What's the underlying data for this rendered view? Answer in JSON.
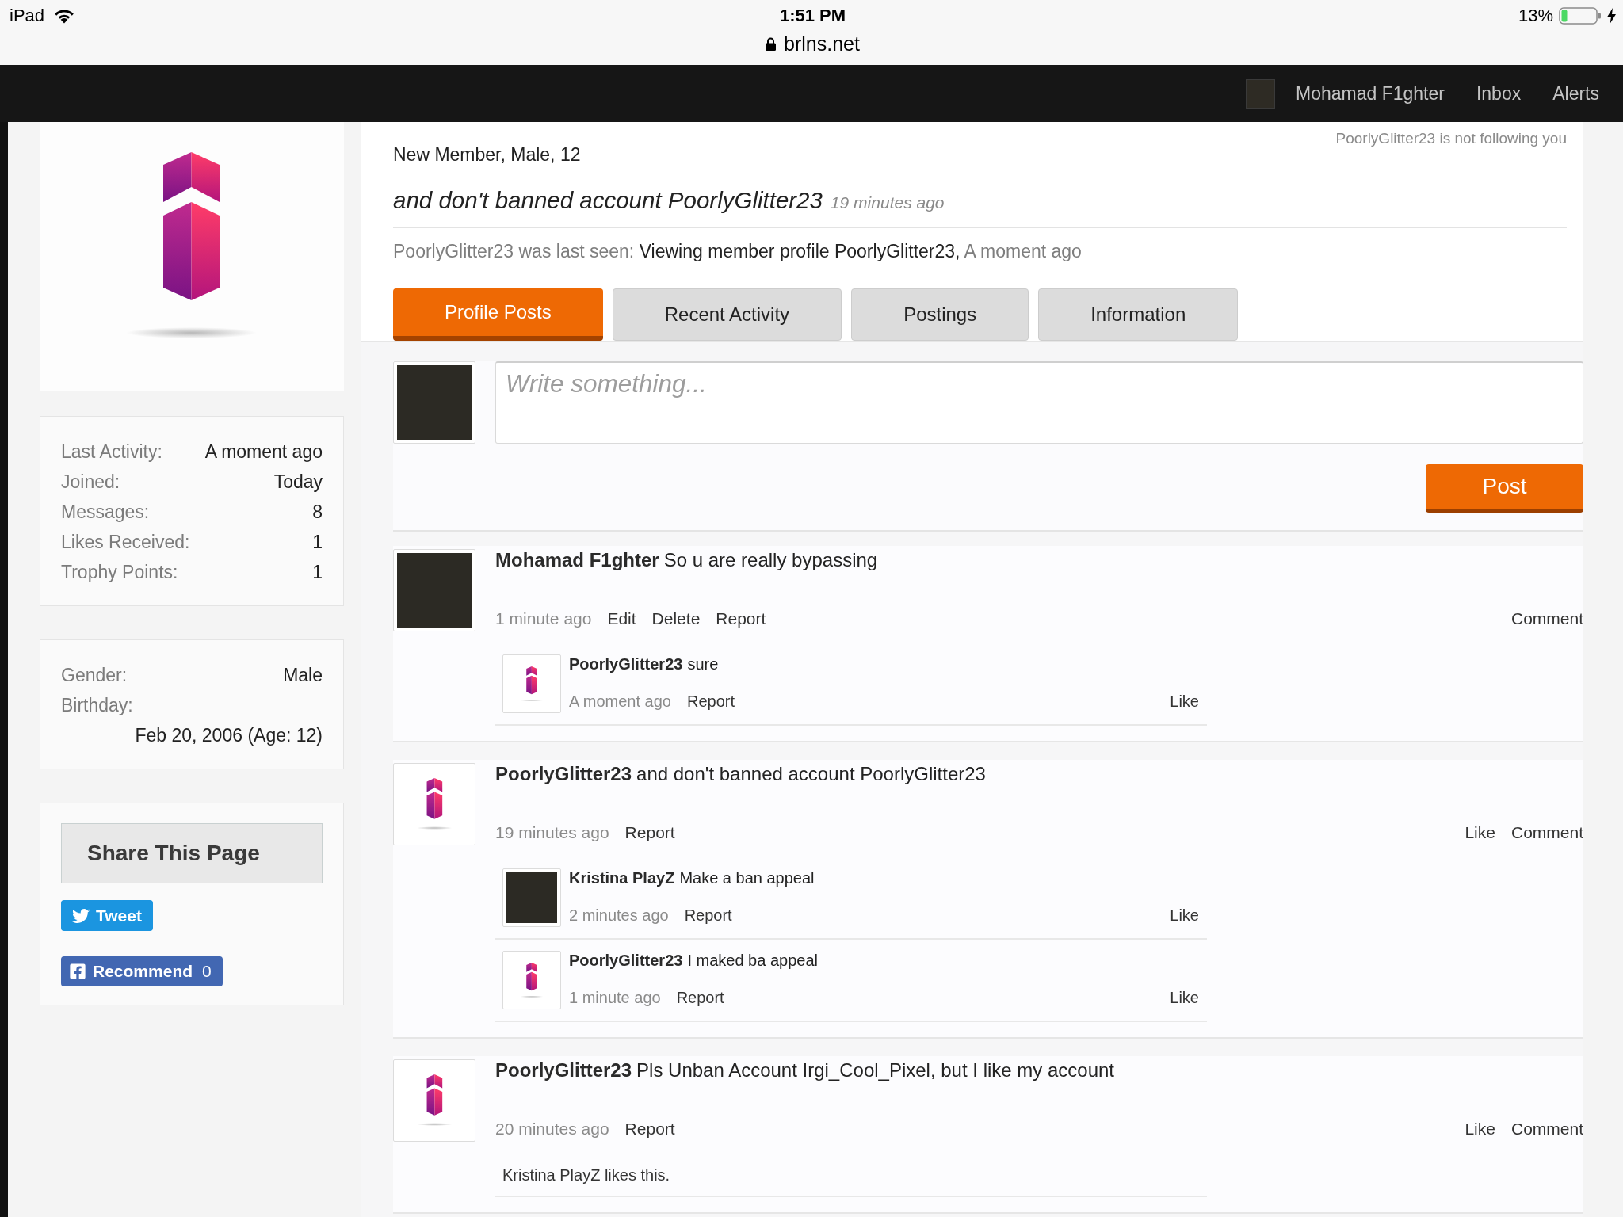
{
  "status_bar": {
    "device": "iPad",
    "time": "1:51 PM",
    "url": "brlns.net",
    "battery": "13%"
  },
  "nav": {
    "user": "Mohamad F1ghter",
    "links": [
      "Inbox",
      "Alerts"
    ]
  },
  "sidebar": {
    "stats": [
      {
        "label": "Last Activity:",
        "value": "A moment ago"
      },
      {
        "label": "Joined:",
        "value": "Today"
      },
      {
        "label": "Messages:",
        "value": "8"
      },
      {
        "label": "Likes Received:",
        "value": "1"
      },
      {
        "label": "Trophy Points:",
        "value": "1"
      }
    ],
    "details": [
      {
        "label": "Gender:",
        "value": "Male"
      },
      {
        "label": "Birthday:",
        "value": "Feb 20, 2006 (Age: 12)"
      }
    ],
    "share": {
      "title": "Share This Page",
      "tweet": "Tweet",
      "recommend": "Recommend",
      "recommend_count": "0"
    }
  },
  "profile": {
    "follow_status": "PoorlyGlitter23 is not following you",
    "subtitle": "New Member, Male, 12",
    "status_message": "and don't banned account PoorlyGlitter23",
    "status_time": "19 minutes ago",
    "last_seen": {
      "label": "PoorlyGlitter23 was last seen:",
      "activity": "Viewing member profile PoorlyGlitter23,",
      "time": "A moment ago"
    }
  },
  "tabs": [
    {
      "label": "Profile Posts",
      "selected": true
    },
    {
      "label": "Recent Activity",
      "selected": false
    },
    {
      "label": "Postings",
      "selected": false
    },
    {
      "label": "Information",
      "selected": false
    }
  ],
  "composer": {
    "placeholder": "Write something...",
    "button": "Post"
  },
  "posts": [
    {
      "avatar": {
        "kind": "photo"
      },
      "author": "Mohamad F1ghter",
      "message": "So u are really bypassing",
      "time": "1 minute ago",
      "actions": [
        "Edit",
        "Delete",
        "Report"
      ],
      "right_actions": [
        "Comment"
      ],
      "comments": [
        {
          "avatar": {
            "kind": "logo"
          },
          "author": "PoorlyGlitter23",
          "message": "sure",
          "time": "A moment ago",
          "actions": [
            "Report"
          ],
          "right_actions": [
            "Like"
          ]
        }
      ]
    },
    {
      "avatar": {
        "kind": "logo"
      },
      "author": "PoorlyGlitter23",
      "message": "and don't banned account PoorlyGlitter23",
      "time": "19 minutes ago",
      "actions": [
        "Report"
      ],
      "right_actions": [
        "Like",
        "Comment"
      ],
      "comments": [
        {
          "avatar": {
            "kind": "photo"
          },
          "author": "Kristina PlayZ",
          "message": "Make a ban appeal",
          "time": "2 minutes ago",
          "actions": [
            "Report"
          ],
          "right_actions": [
            "Like"
          ]
        },
        {
          "avatar": {
            "kind": "logo"
          },
          "author": "PoorlyGlitter23",
          "message": "I maked ba appeal",
          "time": "1 minute ago",
          "actions": [
            "Report"
          ],
          "right_actions": [
            "Like"
          ]
        }
      ]
    },
    {
      "avatar": {
        "kind": "logo"
      },
      "author": "PoorlyGlitter23",
      "message": "Pls Unban Account Irgi_Cool_Pixel, but I like my account",
      "time": "20 minutes ago",
      "actions": [
        "Report"
      ],
      "right_actions": [
        "Like",
        "Comment"
      ],
      "likes": "Kristina PlayZ likes this."
    }
  ]
}
